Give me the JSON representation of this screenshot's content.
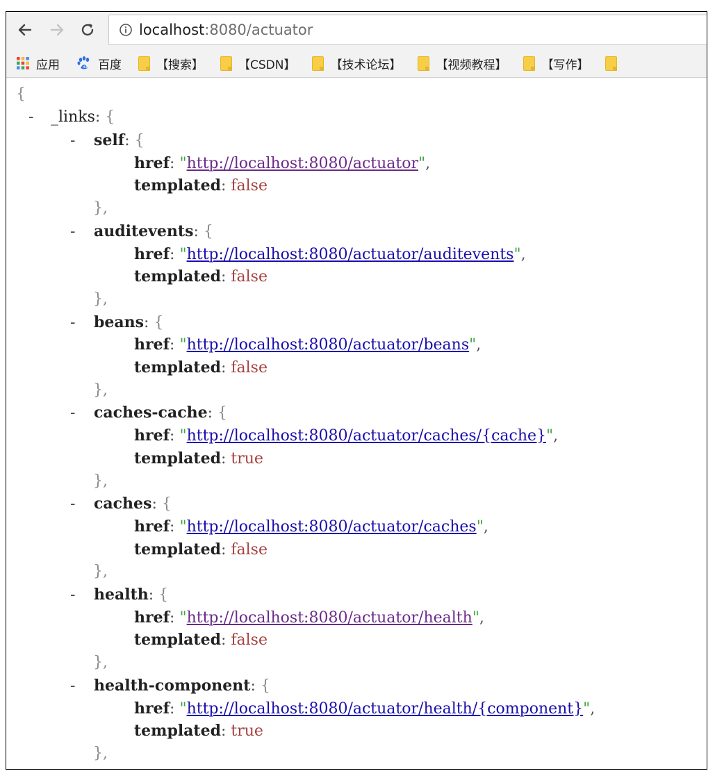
{
  "browser": {
    "address": {
      "host": "localhost",
      "rest": ":8080/actuator"
    }
  },
  "bookmarks": [
    {
      "label": "应用",
      "icon": "apps-grid-icon"
    },
    {
      "label": "百度",
      "icon": "baidu-paw-icon"
    },
    {
      "label": "【搜索】",
      "icon": "folder-icon"
    },
    {
      "label": "【CSDN】",
      "icon": "folder-icon"
    },
    {
      "label": "【技术论坛】",
      "icon": "folder-icon"
    },
    {
      "label": "【视频教程】",
      "icon": "folder-icon"
    },
    {
      "label": "【写作】",
      "icon": "folder-icon"
    },
    {
      "label": "",
      "icon": "folder-icon"
    }
  ],
  "json": {
    "open_brace": "{",
    "collapse_symbol": "-",
    "root_key": "_links",
    "entries": [
      {
        "key": "self",
        "href": "http://localhost:8080/actuator",
        "templated": "false",
        "visited": true
      },
      {
        "key": "auditevents",
        "href": "http://localhost:8080/actuator/auditevents",
        "templated": "false",
        "visited": false
      },
      {
        "key": "beans",
        "href": "http://localhost:8080/actuator/beans",
        "templated": "false",
        "visited": false
      },
      {
        "key": "caches-cache",
        "href": "http://localhost:8080/actuator/caches/{cache}",
        "templated": "true",
        "visited": false
      },
      {
        "key": "caches",
        "href": "http://localhost:8080/actuator/caches",
        "templated": "false",
        "visited": false
      },
      {
        "key": "health",
        "href": "http://localhost:8080/actuator/health",
        "templated": "false",
        "visited": true
      },
      {
        "key": "health-component",
        "href": "http://localhost:8080/actuator/health/{component}",
        "templated": "true",
        "visited": false
      }
    ],
    "href_key": "href",
    "templated_key": "templated",
    "close_entry": "},"
  }
}
